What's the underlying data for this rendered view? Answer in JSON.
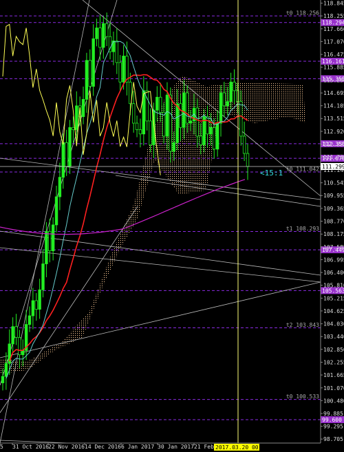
{
  "colors": {
    "background": "#000000",
    "axis_text": "#dddddd",
    "dashed_level": "#8a2be2",
    "level_label_bg": "#9932cc",
    "bull_candle": "#22ee22",
    "yellow_line": "#ffff55",
    "red_ma": "#ff2020",
    "magenta_ma": "#cc22cc",
    "cyan_line": "#66cccc",
    "cloud_dots": "#ffcc99",
    "trend_lines": "#bbbbbb",
    "vertical_marker": "#ffff77",
    "date_badge": "#ffff00",
    "ratio_label": "#33dddd"
  },
  "chart_data": {
    "type": "candlestick",
    "instrument_hint": "USDJPY",
    "price_axis": {
      "ticks": [
        "118.845",
        "118.255",
        "117.660",
        "117.070",
        "116.475",
        "115.885",
        "115.290",
        "114.695",
        "114.105",
        "113.515",
        "112.920",
        "112.325",
        "111.735",
        "111.140",
        "110.545",
        "109.955",
        "109.365",
        "108.770",
        "108.175",
        "107.585",
        "106.995",
        "106.400",
        "105.810",
        "105.215",
        "104.625",
        "104.030",
        "103.440",
        "102.850",
        "102.255",
        "101.665",
        "101.070",
        "100.480",
        "99.885",
        "99.295",
        "98.705"
      ],
      "range": [
        98.52,
        118.99
      ]
    },
    "time_axis": {
      "labels": [
        "5",
        "31 Oct 2016",
        "22 Nov 2016",
        "14 Dec 2016",
        "6 Jan 2017",
        "30 Jan 2017",
        "21 Feb 2"
      ],
      "highlighted_date": "2017.03.20 00:00"
    },
    "current_price": "111.299",
    "levels": [
      {
        "label": "t0 118.256",
        "value": 118.256,
        "badge": false
      },
      {
        "label": "118.294",
        "value": 117.95,
        "badge": true
      },
      {
        "label": "116.161",
        "value": 116.161,
        "badge": true
      },
      {
        "label": "115.355",
        "value": 115.355,
        "badge": true
      },
      {
        "label": "112.350",
        "value": 112.35,
        "badge": true
      },
      {
        "label": "111.676",
        "value": 111.676,
        "badge": true
      },
      {
        "label": "t0 111.042",
        "value": 111.042,
        "badge": false
      },
      {
        "label": "t1 108.293",
        "value": 108.293,
        "badge": false
      },
      {
        "label": "107.449",
        "value": 107.449,
        "badge": true
      },
      {
        "label": "105.563",
        "value": 105.563,
        "badge": true
      },
      {
        "label": "t2 103.843",
        "value": 103.843,
        "badge": false
      },
      {
        "label": "t0 100.533",
        "value": 100.533,
        "badge": false
      },
      {
        "label": "99.600",
        "value": 99.6,
        "badge": true
      }
    ],
    "annotation": "<15:1",
    "closes": [
      101.6,
      102.2,
      103.1,
      103.9,
      103.4,
      102.6,
      102.8,
      104.0,
      104.4,
      105.1,
      104.7,
      105.6,
      106.8,
      108.3,
      107.4,
      108.6,
      109.9,
      110.8,
      112.4,
      111.3,
      113.1,
      113.0,
      114.1,
      113.6,
      114.4,
      116.2,
      115.0,
      117.2,
      117.7,
      116.8,
      117.9,
      117.3,
      116.6,
      117.1,
      116.1,
      115.2,
      116.4,
      115.2,
      114.2,
      113.3,
      113.0,
      112.8,
      114.8,
      113.4,
      112.3,
      113.9,
      114.5,
      113.8,
      112.7,
      114.6,
      112.0,
      112.4,
      114.2,
      113.1,
      114.7,
      113.3,
      113.4,
      114.0,
      112.7,
      112.3,
      113.6,
      112.8,
      113.1,
      112.1,
      113.3,
      114.7,
      114.1,
      114.3,
      115.2,
      114.8,
      114.3,
      112.7,
      111.9,
      111.3
    ]
  }
}
